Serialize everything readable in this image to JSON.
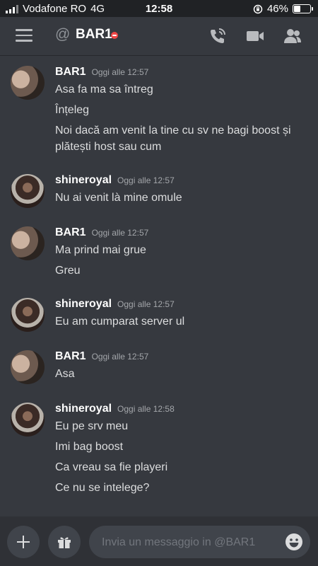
{
  "status": {
    "carrier": "Vodafone RO",
    "network": "4G",
    "time": "12:58",
    "battery": "46%",
    "battery_level": 0.46
  },
  "header": {
    "channel_prefix": "@",
    "title": "BAR1",
    "icons": [
      "menu-icon",
      "call-icon",
      "video-icon",
      "members-icon"
    ]
  },
  "messages": [
    {
      "author": "BAR1",
      "timestamp": "Oggi alle 12:57",
      "lines": [
        "Asa fa ma sa întreg",
        "Înțeleg",
        "Noi dacă am venit la tine cu sv ne bagi boost și",
        "plătești host sau cum"
      ]
    },
    {
      "author": "shineroyal",
      "timestamp": "Oggi alle 12:57",
      "lines": [
        "Nu ai venit là mine omule"
      ]
    },
    {
      "author": "BAR1",
      "timestamp": "Oggi alle 12:57",
      "lines": [
        "Ma prind mai grue",
        "Greu"
      ]
    },
    {
      "author": "shineroyal",
      "timestamp": "Oggi alle 12:57",
      "lines": [
        "Eu am cumparat server ul"
      ]
    },
    {
      "author": "BAR1",
      "timestamp": "Oggi alle 12:57",
      "lines": [
        "Asa"
      ]
    },
    {
      "author": "shineroyal",
      "timestamp": "Oggi alle 12:58",
      "lines": [
        "Eu pe srv meu",
        "Imi bag boost",
        "Ca vreau sa fie playeri",
        "Ce nu se intelege?"
      ]
    }
  ],
  "composer": {
    "placeholder": "Invia un messaggio in @BAR1"
  },
  "colors": {
    "background": "#36393f",
    "composer_bar": "#2f3136",
    "dnd": "#f04747"
  }
}
